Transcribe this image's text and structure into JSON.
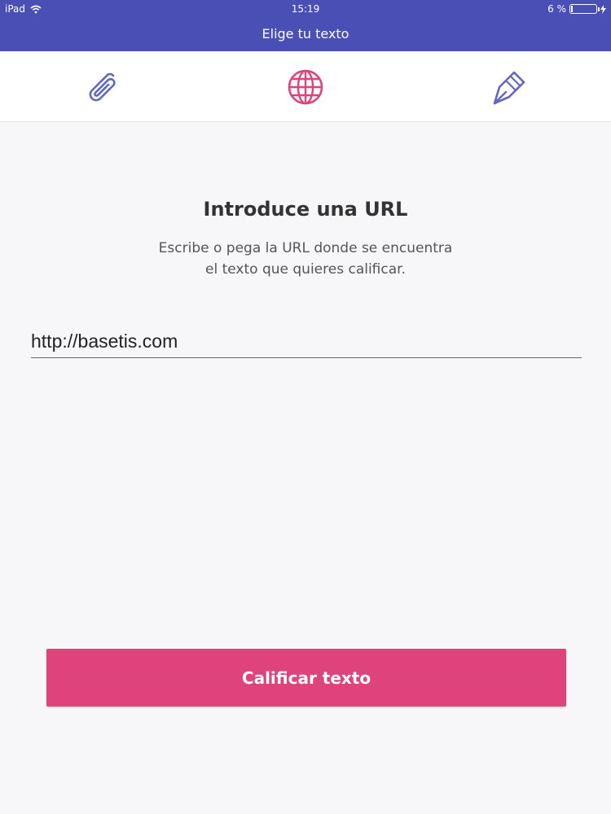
{
  "status_bar": {
    "device": "iPad",
    "time": "15:19",
    "battery": "6 %",
    "wifi_icon": "wifi-icon",
    "battery_icon": "battery-icon"
  },
  "nav": {
    "title": "Elige tu texto"
  },
  "tabs": [
    {
      "icon": "paperclip-icon"
    },
    {
      "icon": "globe-icon",
      "selected": true
    },
    {
      "icon": "pen-nib-icon"
    }
  ],
  "main": {
    "heading": "Introduce una URL",
    "description_line1": "Escribe o pega la URL donde se encuentra",
    "description_line2": "el texto que quieres calificar.",
    "url_value": "http://basetis.com"
  },
  "action": {
    "label": "Calificar texto"
  },
  "colors": {
    "header_bg": "#4a4fb5",
    "accent": "#de437c",
    "icon_inactive": "#6167c2"
  }
}
